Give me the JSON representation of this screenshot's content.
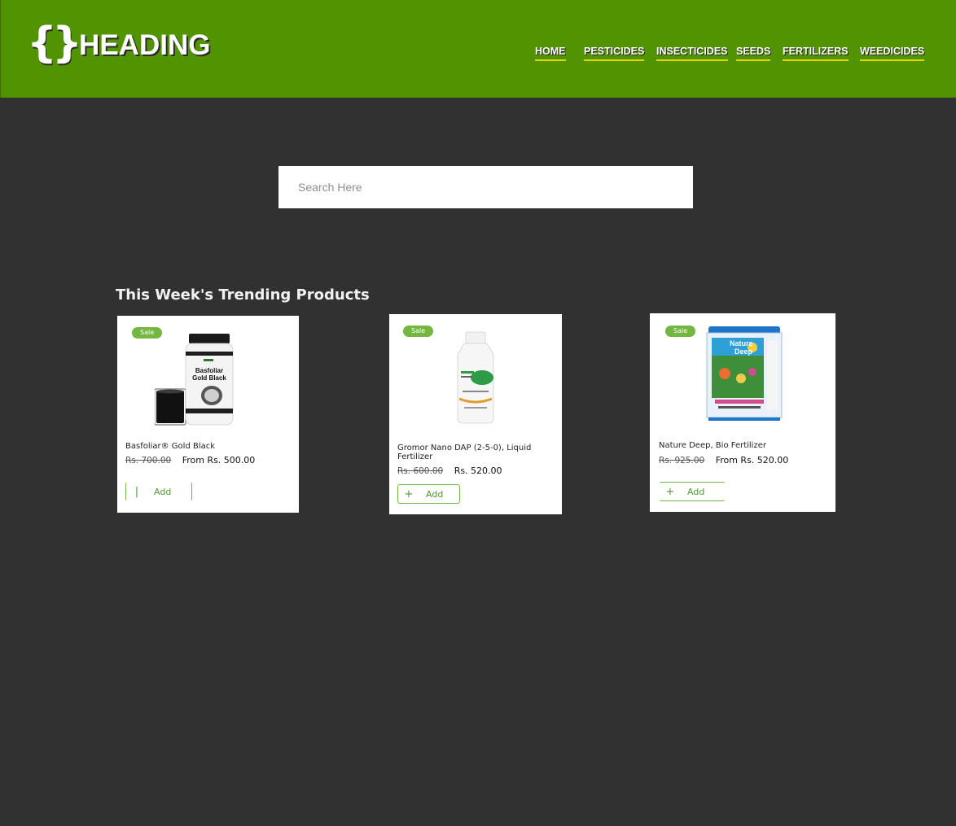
{
  "header": {
    "logo_braces": "{}",
    "logo_text": "HEADING",
    "nav": [
      {
        "label": "HOME"
      },
      {
        "label": "PESTICIDES"
      },
      {
        "label": "INSECTICIDES"
      },
      {
        "label": "SEEDS"
      },
      {
        "label": "FERTILIZERS"
      },
      {
        "label": "WEEDICIDES"
      }
    ]
  },
  "search": {
    "placeholder": "Search Here",
    "value": ""
  },
  "section": {
    "title": "This Week's Trending Products"
  },
  "products": [
    {
      "badge": "Sale",
      "name": "Basfoliar® Gold Black",
      "old_price": "Rs. 700.00",
      "new_price": "From Rs. 500.00",
      "button_icon": "|",
      "button_label": "Add"
    },
    {
      "badge": "Sale",
      "name": "Gromor Nano DAP (2-5-0), Liquid Fertilizer",
      "old_price": "Rs. 600.00",
      "new_price": "Rs. 520.00",
      "button_icon": "+",
      "button_label": "Add"
    },
    {
      "badge": "Sale",
      "name": "Nature Deep, Bio Fertilizer",
      "old_price": "Rs. 925.00",
      "new_price": "From Rs. 520.00",
      "button_icon": "+",
      "button_label": "Add"
    }
  ],
  "colors": {
    "header_bg": "#529302",
    "page_bg": "#313131",
    "nav_underline": "#e3d700",
    "accent_green": "#73b741"
  }
}
